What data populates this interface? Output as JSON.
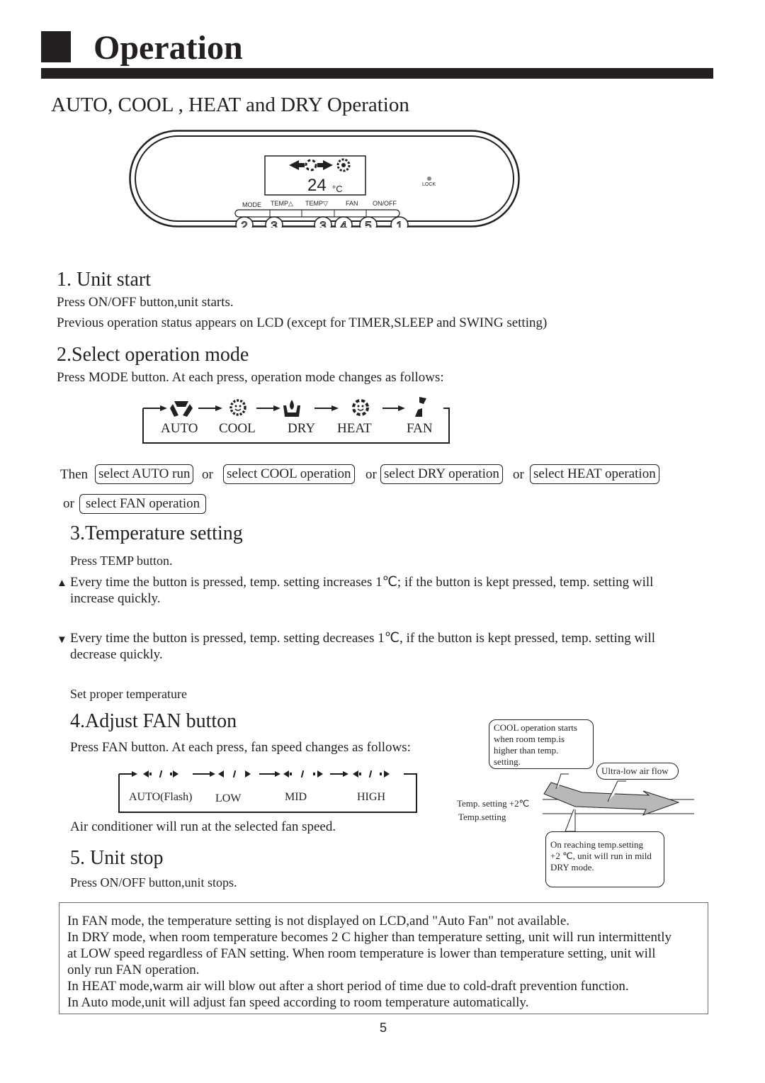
{
  "header": {
    "title": "Operation",
    "subtitle": "AUTO, COOL , HEAT and DRY Operation"
  },
  "remote": {
    "lcd_temperature": "24",
    "lcd_unit": "°C",
    "lock_label": "LOCK",
    "buttons": [
      {
        "label": "MODE",
        "step": "2"
      },
      {
        "label": "TEMP△",
        "step": "3"
      },
      {
        "label": "TEMP▽",
        "step": "3"
      },
      {
        "label": "FAN",
        "step": "4"
      },
      {
        "label": "ON/OFF",
        "step": "1"
      }
    ],
    "extra_step": "5"
  },
  "sections": {
    "unit_start": {
      "heading": "1. Unit start",
      "lines": [
        "Press ON/OFF button,unit starts.",
        "Previous operation status appears on LCD (except for TIMER,SLEEP and SWING setting)"
      ]
    },
    "select_mode": {
      "heading": "2.Select operation mode",
      "text": "Press MODE button. At each press, operation mode changes as follows:",
      "modes": [
        {
          "label": "AUTO",
          "icon": "auto-icon"
        },
        {
          "label": "COOL",
          "icon": "cool-icon"
        },
        {
          "label": "DRY",
          "icon": "dry-icon"
        },
        {
          "label": "HEAT",
          "icon": "heat-icon"
        },
        {
          "label": "FAN",
          "icon": "fan-icon"
        }
      ],
      "then_label": "Then",
      "or_label": "or",
      "options": [
        "select AUTO run",
        "select COOL operation",
        "select DRY operation",
        "select HEAT operation",
        "select FAN operation"
      ]
    },
    "temperature": {
      "heading": "3.Temperature setting",
      "press": "Press TEMP button.",
      "up_symbol": "▲",
      "up_line1": "Every time the button is pressed, temp. setting increases 1℃; if the button is kept pressed, temp. setting will",
      "up_line2": "increase quickly.",
      "down_symbol": "▼",
      "down_line1": "Every time the button is pressed, temp. setting decreases 1℃, if the button is kept pressed, temp. setting will",
      "down_line2": "decrease quickly.",
      "set_proper": "Set proper temperature"
    },
    "fan": {
      "heading": "4.Adjust FAN button",
      "text": "Press FAN button. At each press, fan speed changes as follows:",
      "speeds": [
        "AUTO(Flash)",
        "LOW",
        "MID",
        "HIGH"
      ],
      "after": "Air conditioner will run at the selected fan speed."
    },
    "stop": {
      "heading": "5. Unit stop",
      "text": "Press ON/OFF button,unit stops."
    }
  },
  "dry_diagram": {
    "callout_cool": [
      "COOL operation starts",
      "when room temp.is",
      "higher than temp.",
      "setting."
    ],
    "callout_airflow": "Ultra-low air flow",
    "label_plus2": "Temp. setting +2℃",
    "label_setting": "Temp.setting",
    "callout_dry": [
      "On reaching temp.setting",
      "+2 ℃, unit will run in mild",
      "DRY mode."
    ]
  },
  "notes": [
    "In FAN mode, the temperature setting is not displayed on LCD,and \"Auto Fan\" not available.",
    "In DRY mode, when room temperature becomes 2 C higher than temperature setting, unit will run intermittently",
    "at LOW speed regardless of FAN setting. When room temperature is lower than temperature setting, unit will",
    "only run FAN operation.",
    "In HEAT mode,warm air will blow out after a short period of time due to cold-draft prevention function.",
    "In Auto mode,unit will adjust fan speed according to room temperature automatically."
  ],
  "page_number": "5"
}
